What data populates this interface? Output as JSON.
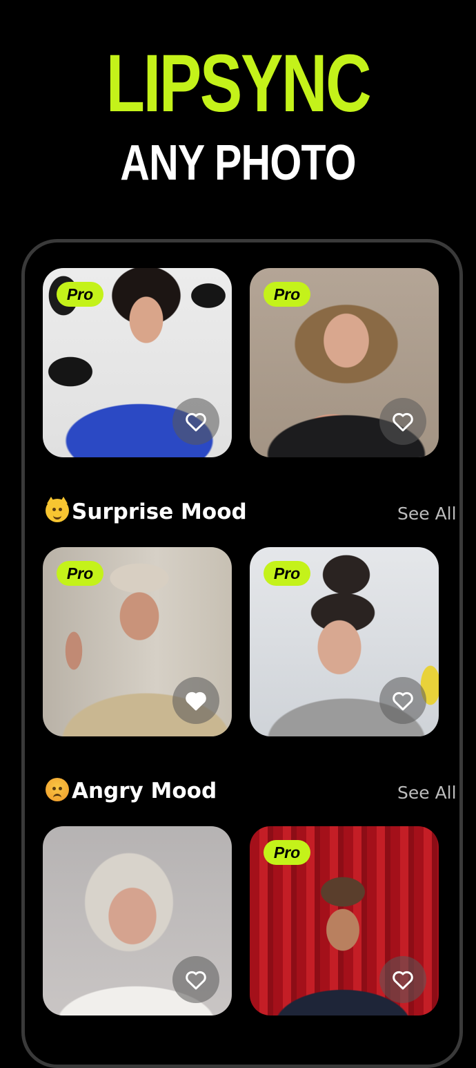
{
  "header": {
    "title": "LIPSYNC",
    "subtitle": "ANY PHOTO"
  },
  "colors": {
    "accent": "#c4f21a",
    "background": "#000000"
  },
  "top_row": {
    "cards": [
      {
        "badge": "Pro",
        "favorite": "heart-outline-icon"
      },
      {
        "badge": "Pro",
        "favorite": "heart-outline-icon"
      }
    ]
  },
  "sections": [
    {
      "emoji": "grinning-cat-emoji",
      "title": "Surprise Mood",
      "see_all": "See All",
      "cards": [
        {
          "badge": "Pro",
          "favorite": "heart-filled-icon"
        },
        {
          "badge": "Pro",
          "favorite": "heart-outline-icon"
        }
      ]
    },
    {
      "emoji": "angry-face-emoji",
      "title": "Angry Mood",
      "see_all": "See All",
      "cards": [
        {
          "badge": "",
          "favorite": "heart-outline-icon"
        },
        {
          "badge": "Pro",
          "favorite": "heart-outline-icon"
        }
      ]
    }
  ]
}
